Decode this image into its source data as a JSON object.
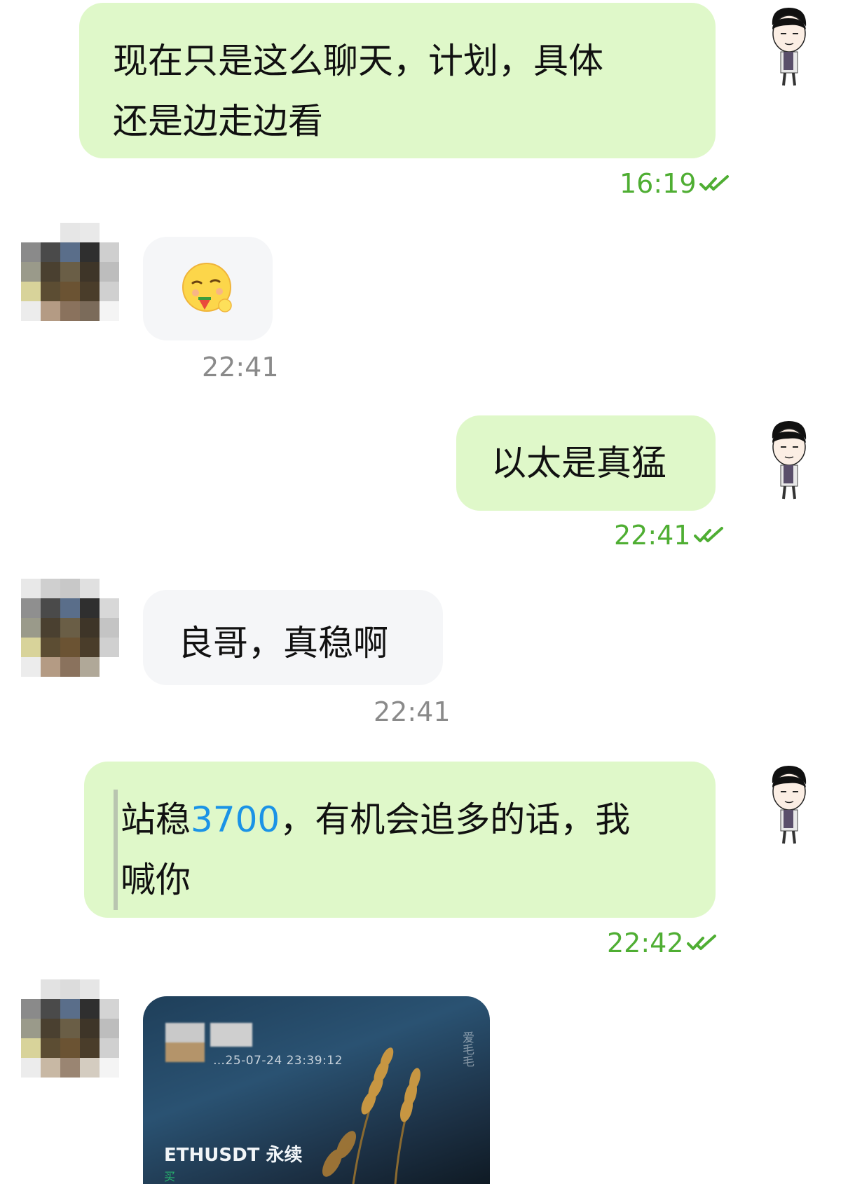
{
  "messages": [
    {
      "id": "m1",
      "direction": "out",
      "lines": [
        "现在只是这么聊天，计划，具体",
        "还是边走边看"
      ],
      "time": "16:19"
    },
    {
      "id": "m2",
      "direction": "in",
      "emoji": "🤤",
      "time": "22:41"
    },
    {
      "id": "m3",
      "direction": "out",
      "text": "以太是真猛",
      "time": "22:41"
    },
    {
      "id": "m4",
      "direction": "in",
      "text": "良哥，真稳啊",
      "time": "22:41"
    },
    {
      "id": "m5",
      "direction": "out",
      "line1_before": "站稳",
      "line1_highlight": "3700",
      "line1_after": "，有机会追多的话，我",
      "line2": "喊你",
      "time": "22:42"
    },
    {
      "id": "m6",
      "direction": "in",
      "card": {
        "date": "…25-07-24 23:39:12",
        "symbol": "ETHUSDT 永续",
        "side": "买",
        "watermark": "爱毛毛"
      }
    }
  ],
  "colors": {
    "out_bubble": "#dff8c9",
    "in_bubble": "#f5f6f8",
    "out_time": "#4fae33",
    "in_time": "#8a8a8a",
    "highlight": "#1b93e6"
  },
  "icons": {
    "read_receipt": "double-check-icon",
    "self_avatar": "cartoon-man-avatar",
    "contact_avatar": "pixelated-avatar"
  }
}
